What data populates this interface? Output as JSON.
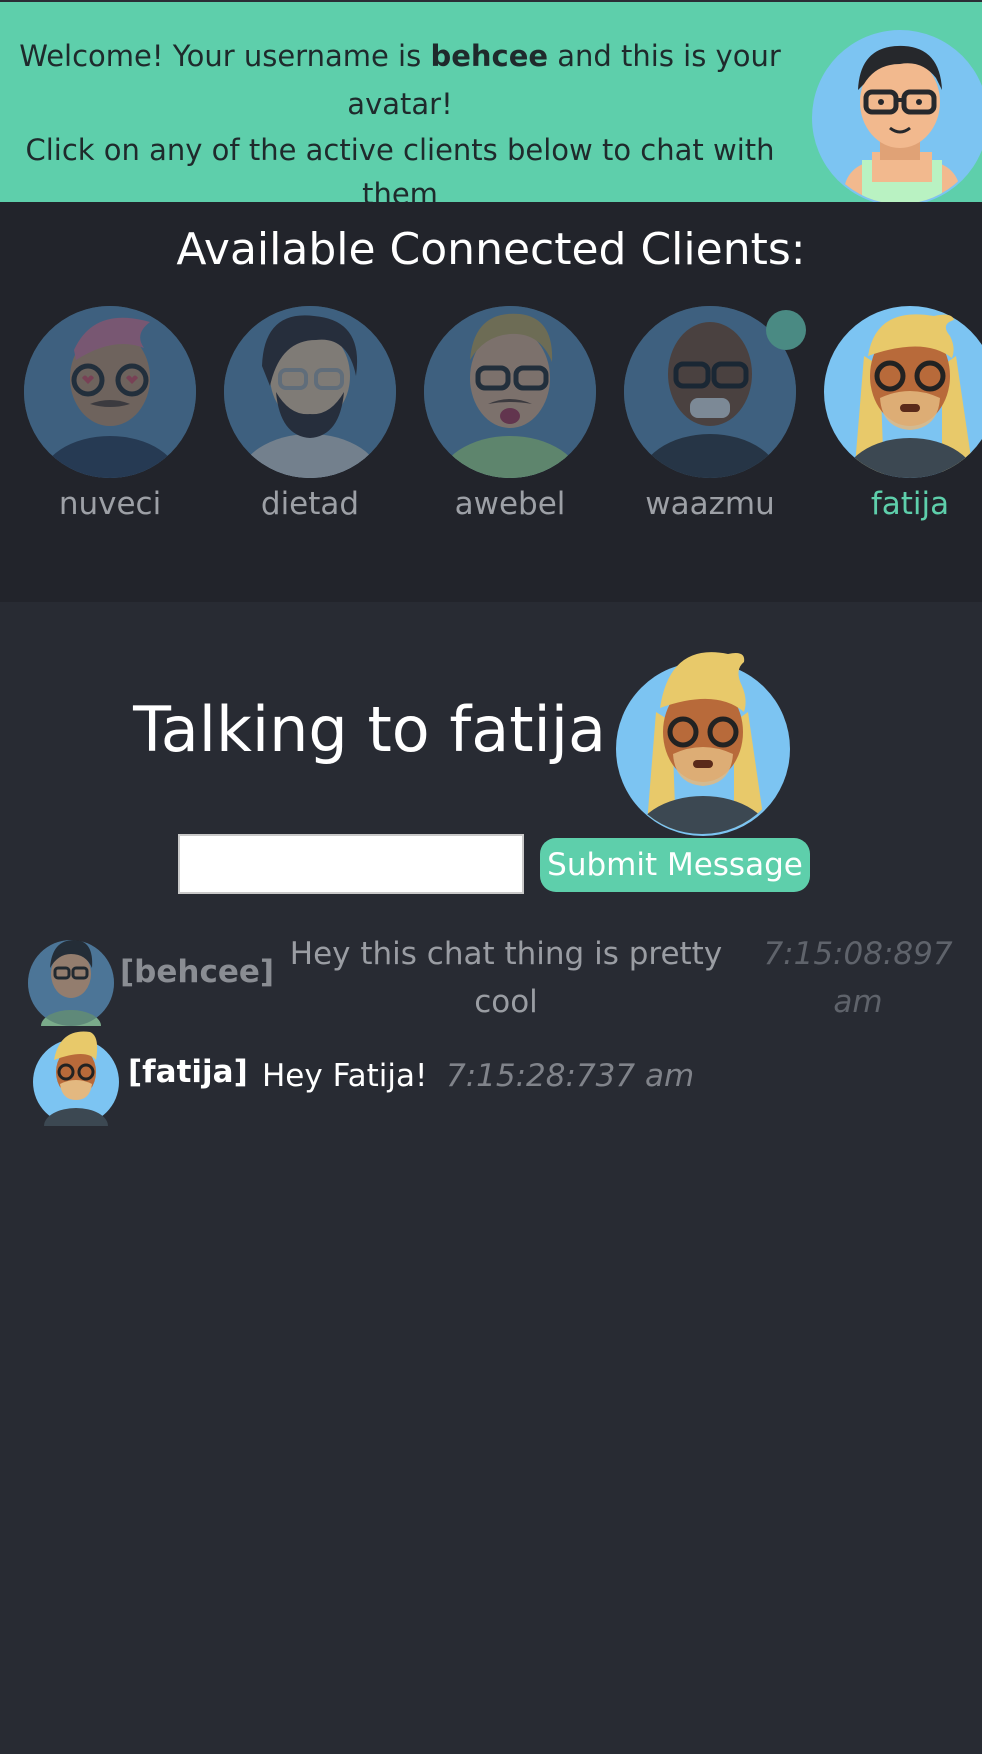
{
  "banner": {
    "welcome_prefix": "Welcome! Your username is ",
    "username": "behcee",
    "welcome_suffix": " and this is your avatar!",
    "instructions": "Click on any of the active clients below to chat with them",
    "background_color": "#5ecfab"
  },
  "clients": {
    "title": "Available Connected Clients:",
    "items": [
      {
        "name": "nuveci",
        "state": "inactive"
      },
      {
        "name": "dietad",
        "state": "inactive"
      },
      {
        "name": "awebel",
        "state": "inactive"
      },
      {
        "name": "waazmu",
        "state": "inactive",
        "online_indicator": true
      },
      {
        "name": "fatija",
        "state": "selected"
      }
    ],
    "accent_color": "#5ecfab"
  },
  "chat": {
    "title": "Talking to fatija",
    "input_value": "",
    "submit_label": "Submit Message",
    "messages": [
      {
        "sender": "[behcee]",
        "text": "Hey this chat thing is pretty cool",
        "time": "7:15:08:897 am"
      },
      {
        "sender": "[fatija]",
        "text": "Hey Fatija!",
        "time": "7:15:28:737 am"
      }
    ]
  }
}
